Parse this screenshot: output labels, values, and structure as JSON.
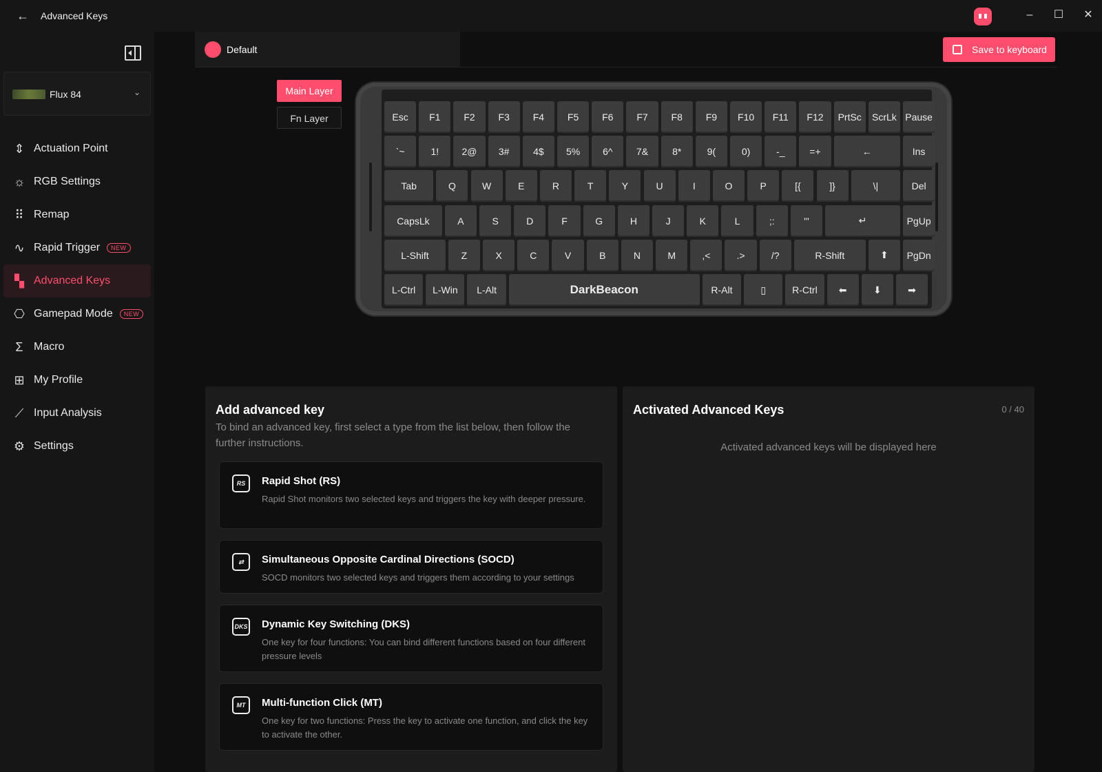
{
  "window": {
    "title": "Advanced Keys",
    "back_icon": "arrow-left-icon",
    "controls": [
      "minimize-icon",
      "maximize-icon",
      "close-icon"
    ]
  },
  "device": {
    "name": "Flux 84"
  },
  "nav": [
    {
      "label": "Actuation Point",
      "icon": "actuation-icon"
    },
    {
      "label": "RGB Settings",
      "icon": "sun-icon"
    },
    {
      "label": "Remap",
      "icon": "grid-icon"
    },
    {
      "label": "Rapid Trigger",
      "icon": "pulse-icon",
      "badge": "NEW"
    },
    {
      "label": "Advanced Keys",
      "icon": "advanced-keys-icon",
      "active": true
    },
    {
      "label": "Gamepad Mode",
      "icon": "gamepad-icon",
      "badge": "NEW"
    },
    {
      "label": "Macro",
      "icon": "sigma-icon"
    },
    {
      "label": "My Profile",
      "icon": "profile-grid-icon"
    },
    {
      "label": "Input Analysis",
      "icon": "chart-icon"
    },
    {
      "label": "Settings",
      "icon": "gear-icon"
    }
  ],
  "profile": {
    "name": "Default"
  },
  "save_button": "Save to keyboard",
  "layers": {
    "main": "Main Layer",
    "fn": "Fn Layer"
  },
  "keyboard": {
    "rows": [
      [
        "Esc",
        "F1",
        "F2",
        "F3",
        "F4",
        "F5",
        "F6",
        "F7",
        "F8",
        "F9",
        "F10",
        "F11",
        "F12",
        "PrtSc",
        "ScrLk",
        "Pause"
      ],
      [
        "`~",
        "1!",
        "2@",
        "3#",
        "4$",
        "5%",
        "6^",
        "7&",
        "8*",
        "9(",
        "0)",
        "-_",
        "=+",
        "←",
        "Ins"
      ],
      [
        "Tab",
        "Q",
        "W",
        "E",
        "R",
        "T",
        "Y",
        "U",
        "I",
        "O",
        "P",
        "[{",
        "]}",
        "\\|",
        "Del"
      ],
      [
        "CapsLk",
        "A",
        "S",
        "D",
        "F",
        "G",
        "H",
        "J",
        "K",
        "L",
        ";:",
        "'\"",
        "↵",
        "PgUp"
      ],
      [
        "L-Shift",
        "Z",
        "X",
        "C",
        "V",
        "B",
        "N",
        "M",
        ",<",
        ".>",
        "/?",
        "R-Shift",
        "⬆",
        "PgDn"
      ],
      [
        "L-Ctrl",
        "L-Win",
        "L-Alt",
        "DarkBeacon",
        "R-Alt",
        "▯",
        "R-Ctrl",
        "⬅",
        "⬇",
        "➡"
      ]
    ]
  },
  "add_panel": {
    "title": "Add advanced key",
    "description": "To bind an advanced key, first select a type from the list below, then follow the further instructions.",
    "items": [
      {
        "title": "Rapid Shot (RS)",
        "icon_text": "RS",
        "description": "Rapid Shot monitors two selected keys and triggers the key with deeper pressure."
      },
      {
        "title": "Simultaneous Opposite Cardinal Directions (SOCD)",
        "icon_text": "⇄",
        "description": "SOCD monitors two selected keys and triggers them according to your settings"
      },
      {
        "title": "Dynamic Key Switching (DKS)",
        "icon_text": "DKS",
        "description": "One key for four functions: You can bind different functions based on four different pressure levels"
      },
      {
        "title": "Multi-function Click (MT)",
        "icon_text": "MT",
        "description": "One key for two functions: Press the key to activate one function, and click the key to activate the other."
      }
    ]
  },
  "activated_panel": {
    "title": "Activated Advanced Keys",
    "count": "0 / 40",
    "empty_message": "Activated advanced keys will be displayed here"
  },
  "colors": {
    "accent": "#ff4d6d",
    "background": "#0f0f0f",
    "sidebar": "#161616",
    "key": "#3c3c3c"
  }
}
